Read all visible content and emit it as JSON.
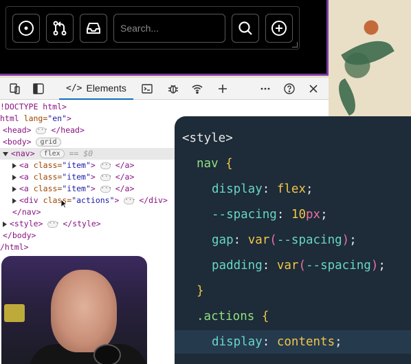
{
  "navbar": {
    "search_placeholder": "Search..."
  },
  "devtools": {
    "tab_elements": "Elements",
    "dom_lines": {
      "doctype": "!DOCTYPE html>",
      "html_open_tag": "html",
      "html_attr": "lang=",
      "html_val": "\"en\"",
      "head_open": "<head>",
      "head_close": "</head>",
      "body_open": "<body>",
      "body_badge": "grid",
      "nav_open": "<nav>",
      "nav_badge": "flex",
      "nav_dollar": "== $0",
      "a_open": "<a",
      "class_attr": "class=",
      "item_val": "\"item\"",
      "gt": ">",
      "a_close": "</a>",
      "div_open": "<div",
      "div_attr_a": "cla",
      "div_attr_b": "ss=",
      "actions_val": "\"actions\"",
      "div_close": "</div>",
      "nav_close": "</nav>",
      "style_open": "<style>",
      "style_close": "</style>",
      "body_close": "</body>",
      "html_close": "/html>"
    }
  },
  "code": {
    "style_open": "<style>",
    "nav_sel": "nav",
    "display_prop": "display",
    "flex_val": "flex",
    "spacing_prop": "--spacing",
    "spacing_num": "10",
    "spacing_unit": "px",
    "gap_prop": "gap",
    "var_fn": "var",
    "var_name": "--spacing",
    "padding_prop": "padding",
    "actions_sel": ".actions",
    "contents_val": "contents"
  },
  "colors": {
    "accent_purple": "#7a3aa5",
    "code_bg": "#1e2b38",
    "devtools_tab_underline": "#0f6cbd"
  }
}
